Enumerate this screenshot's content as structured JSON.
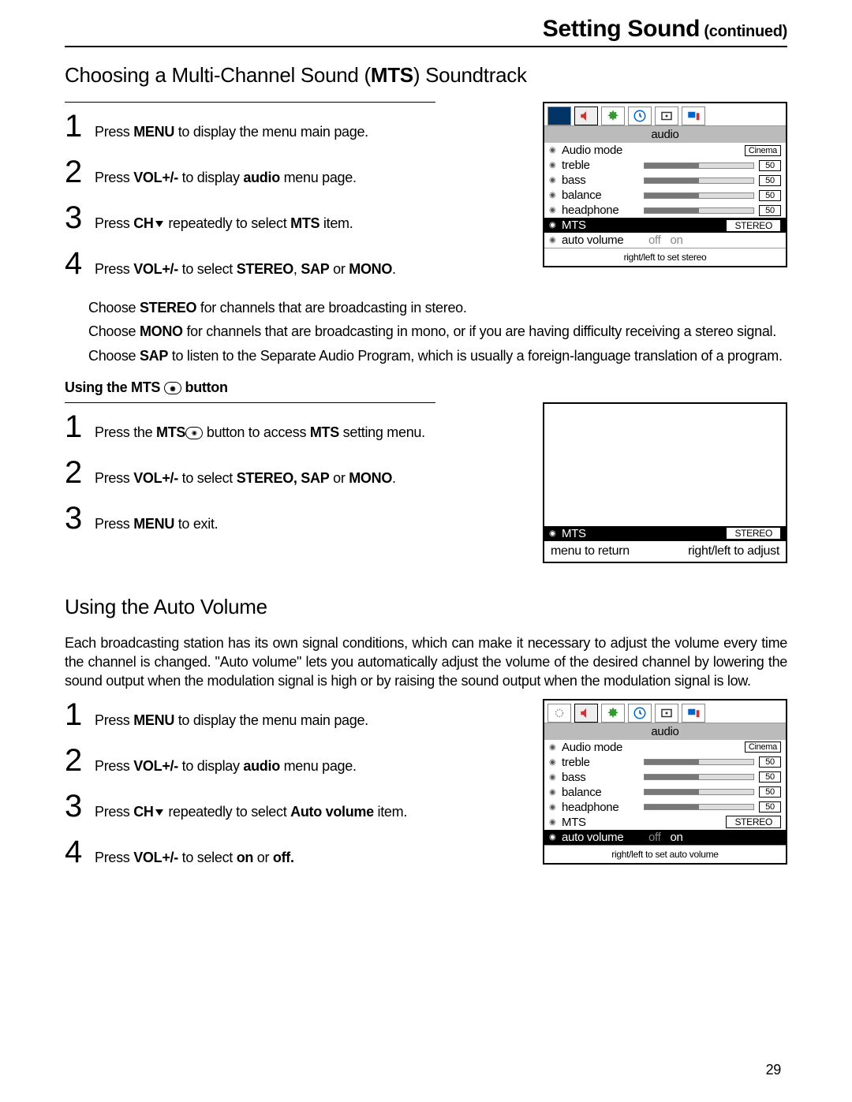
{
  "header": {
    "title": "Setting Sound",
    "cont": " (continued)"
  },
  "section1": {
    "title_pre": "Choosing a Multi-Channel Sound (",
    "title_bold": "MTS",
    "title_post": ") Soundtrack",
    "steps": [
      {
        "n": "1",
        "pre": "Press  ",
        "b1": "MENU",
        "post": " to display the menu main page."
      },
      {
        "n": "2",
        "pre": "Press  ",
        "b1": "VOL+/-",
        "mid": "  to display ",
        "b2": "audio",
        "post": " menu page."
      },
      {
        "n": "3",
        "pre": "Press  ",
        "b1": "CH",
        "mid": " repeatedly to select ",
        "b2": "MTS",
        "post": " item.",
        "chev": true
      },
      {
        "n": "4",
        "pre": "Press  ",
        "b1": "VOL+/-",
        "mid": "  to select ",
        "b2": "STEREO",
        "mid2": ", ",
        "b3": "SAP",
        "mid3": " or ",
        "b4": "MONO",
        "post": "."
      }
    ],
    "para1_pre": "Choose  ",
    "para1_b": "STEREO",
    "para1_post": " for channels that are broadcasting in stereo.",
    "para2_pre": "Choose  ",
    "para2_b": "MONO",
    "para2_post": " for channels that are broadcasting in mono, or if you are having difficulty receiving a stereo signal.",
    "para3_pre": "Choose  ",
    "para3_b": "SAP",
    "para3_post": " to listen to the Separate Audio Program, which is usually a foreign-language translation of a program.",
    "subhead_pre": "Using the MTS ",
    "subhead_post": "  button",
    "steps2": [
      {
        "n": "1",
        "pre": "Press  the ",
        "b1": "MTS",
        "mid": " button to access ",
        "b2": "MTS",
        "post": "  setting menu.",
        "mtsicon": true
      },
      {
        "n": "2",
        "pre": "Press  ",
        "b1": "VOL+/-",
        "mid": "  to select ",
        "b2": "STEREO, SAP",
        "mid2": " or ",
        "b3": "MONO",
        "post": "."
      },
      {
        "n": "3",
        "pre": "Press ",
        "b1": "MENU",
        "post": " to exit."
      }
    ]
  },
  "section2": {
    "title": "Using the Auto Volume",
    "desc": "Each broadcasting station has its own signal conditions, which can make it necessary to adjust the volume every time the channel is changed. \"Auto volume\" lets you automatically adjust the volume of the desired channel by lowering the sound output when the modulation signal is high or by raising the sound output when the modulation signal is low.",
    "steps": [
      {
        "n": "1",
        "pre": "Press  ",
        "b1": "MENU",
        "post": " to display the menu main page."
      },
      {
        "n": "2",
        "pre": "Press  ",
        "b1": "VOL+/-",
        "mid": "  to display ",
        "b2": "audio",
        "post": " menu page."
      },
      {
        "n": "3",
        "pre": "Press  ",
        "b1": "CH",
        "mid": " repeatedly to select ",
        "b2": "Auto volume",
        "post": " item.",
        "chev": true
      },
      {
        "n": "4",
        "pre": "Press  ",
        "b1": "VOL+/-",
        "mid": "  to select ",
        "b2": "on",
        "mid2": " or ",
        "b3": "off.",
        "post": ""
      }
    ]
  },
  "osd_audio": {
    "title": "audio",
    "rows": [
      {
        "label": "Audio mode",
        "val": "Cinema",
        "type": "box"
      },
      {
        "label": "treble",
        "val": "50",
        "type": "slider"
      },
      {
        "label": "bass",
        "val": "50",
        "type": "slider"
      },
      {
        "label": "balance",
        "val": "50",
        "type": "slider"
      },
      {
        "label": "headphone",
        "val": "50",
        "type": "slider"
      },
      {
        "label": "MTS",
        "val": "STEREO",
        "type": "stereo"
      },
      {
        "label": "auto volume",
        "off": "off",
        "on": "on",
        "type": "toggle"
      }
    ],
    "footer_mts": "right/left to set stereo",
    "footer_auto": "right/left to set auto volume"
  },
  "osd_simple": {
    "mts": "MTS",
    "stereo": "STEREO",
    "hint_left": "menu to return",
    "hint_right": "right/left to adjust"
  },
  "page_number": "29"
}
